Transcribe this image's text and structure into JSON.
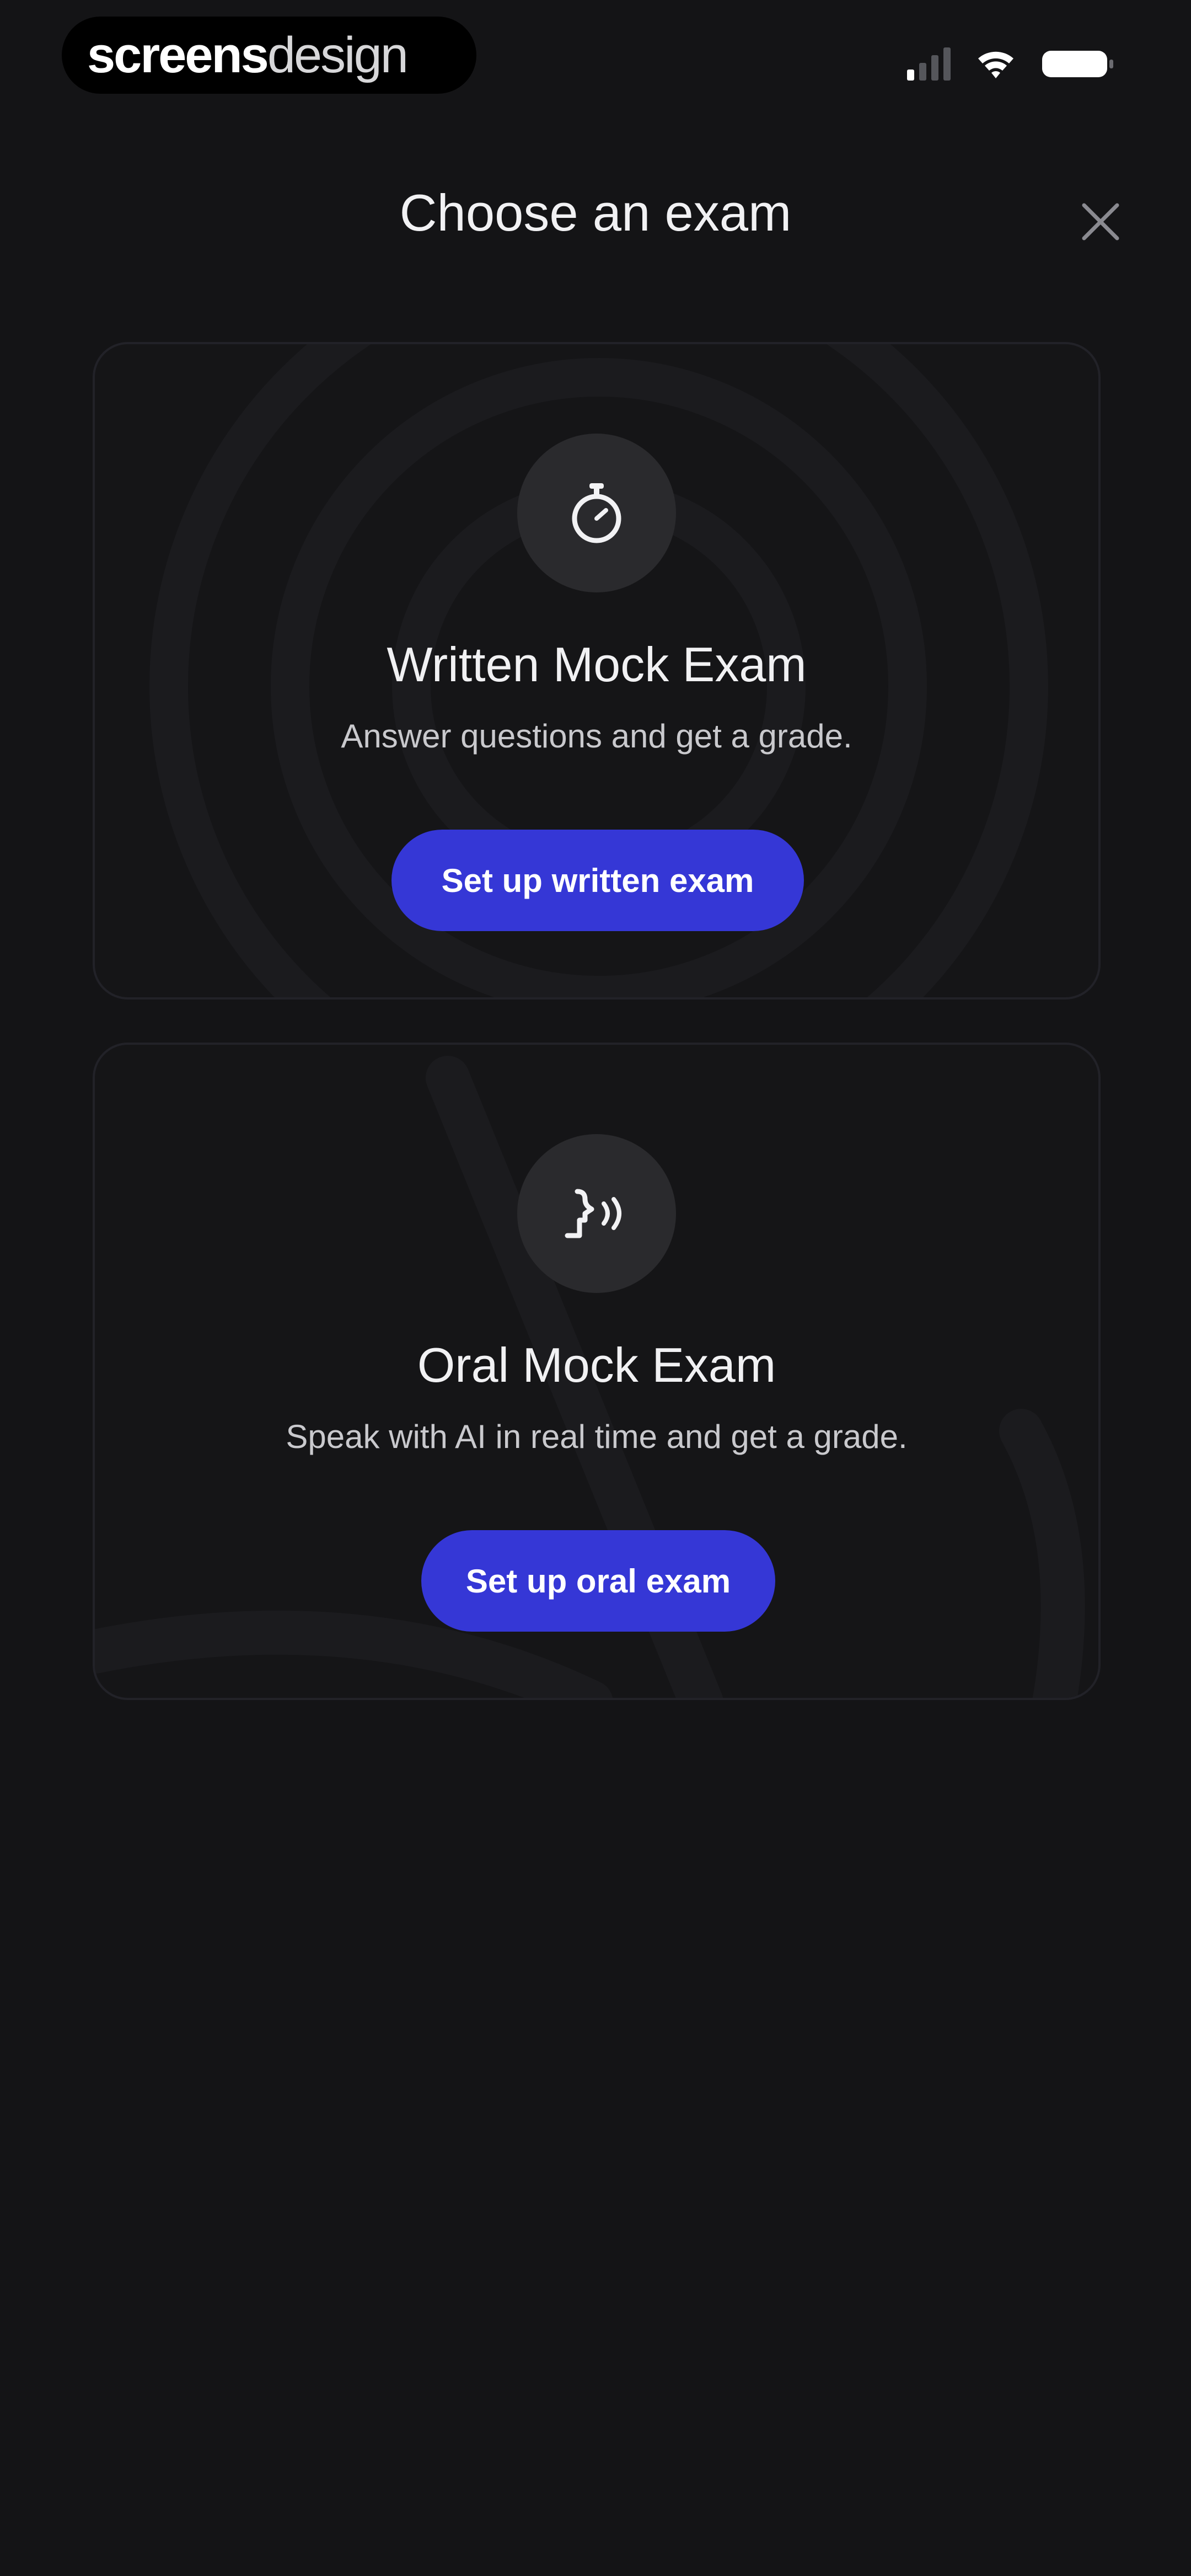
{
  "status_bar": {
    "brand_bold": "screens",
    "brand_light": "design"
  },
  "header": {
    "title": "Choose an exam"
  },
  "cards": [
    {
      "icon": "stopwatch-icon",
      "title": "Written Mock Exam",
      "description": "Answer questions and get a grade.",
      "button_label": "Set up written exam"
    },
    {
      "icon": "speaking-icon",
      "title": "Oral Mock Exam",
      "description": "Speak with AI in real time and get a grade.",
      "button_label": "Set up oral exam"
    }
  ],
  "colors": {
    "background": "#141416",
    "card_border": "#222228",
    "icon_circle": "#2a2a2d",
    "accent_button": "#3537d6"
  }
}
